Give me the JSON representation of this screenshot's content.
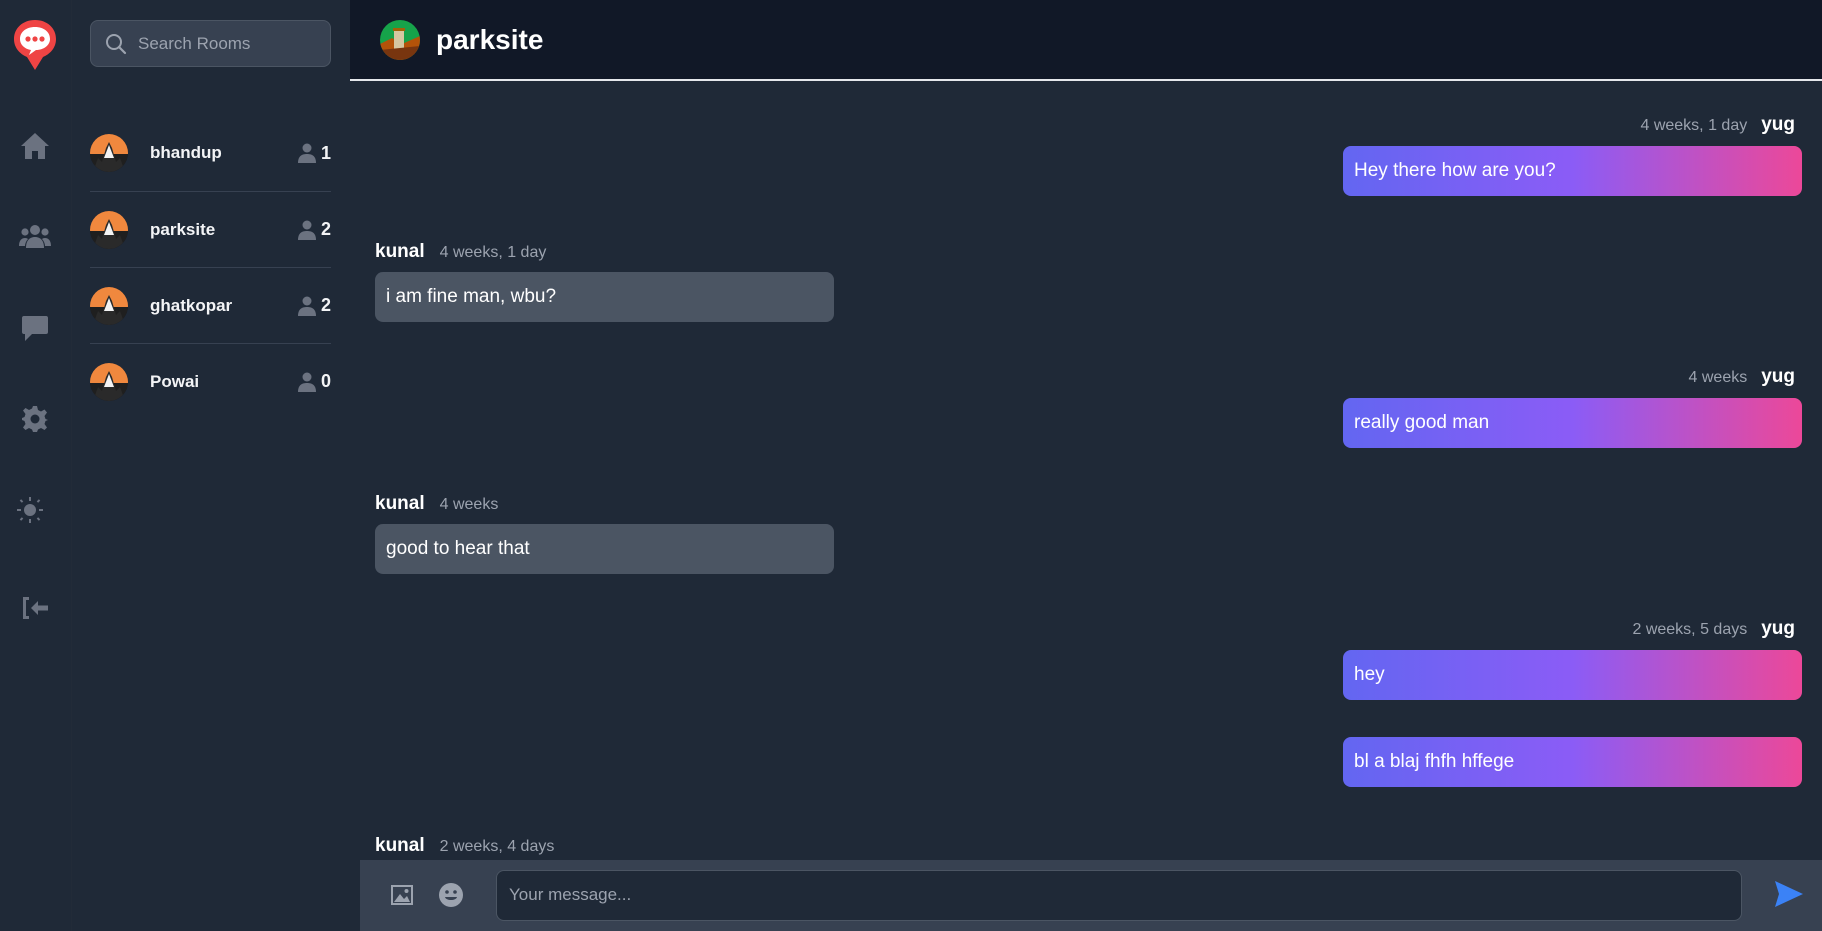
{
  "search": {
    "placeholder": "Search Rooms"
  },
  "rail": {
    "icons": [
      "chat-bubble-logo-icon",
      "home-icon",
      "users-icon",
      "chat-icon",
      "gear-icon",
      "sun-icon",
      "logout-icon"
    ]
  },
  "rooms": [
    {
      "name": "bhandup",
      "members": "1"
    },
    {
      "name": "parksite",
      "members": "2"
    },
    {
      "name": "ghatkopar",
      "members": "2"
    },
    {
      "name": "Powai",
      "members": "0"
    }
  ],
  "header": {
    "title": "parksite"
  },
  "messages": [
    {
      "side": "right",
      "user": "yug",
      "time": "4 weeks, 1 day",
      "text": "Hey there how are you?"
    },
    {
      "side": "left",
      "user": "kunal",
      "time": "4 weeks, 1 day",
      "text": "i am fine man, wbu?"
    },
    {
      "side": "right",
      "user": "yug",
      "time": "4 weeks",
      "text": "really good man"
    },
    {
      "side": "left",
      "user": "kunal",
      "time": "4 weeks",
      "text": "good to hear that"
    },
    {
      "side": "right",
      "user": "yug",
      "time": "2 weeks, 5 days",
      "text": "hey"
    },
    {
      "side": "right",
      "user": "",
      "time": "",
      "text": "bl a blaj fhfh hffege"
    },
    {
      "side": "left",
      "user": "kunal",
      "time": "2 weeks, 4 days",
      "text": ""
    }
  ],
  "composer": {
    "placeholder": "Your message..."
  },
  "colors": {
    "accent_gradient": [
      "#6366f1",
      "#8b5cf6",
      "#ec4899"
    ],
    "send": "#3b82f6",
    "logo": "#ef4444"
  }
}
